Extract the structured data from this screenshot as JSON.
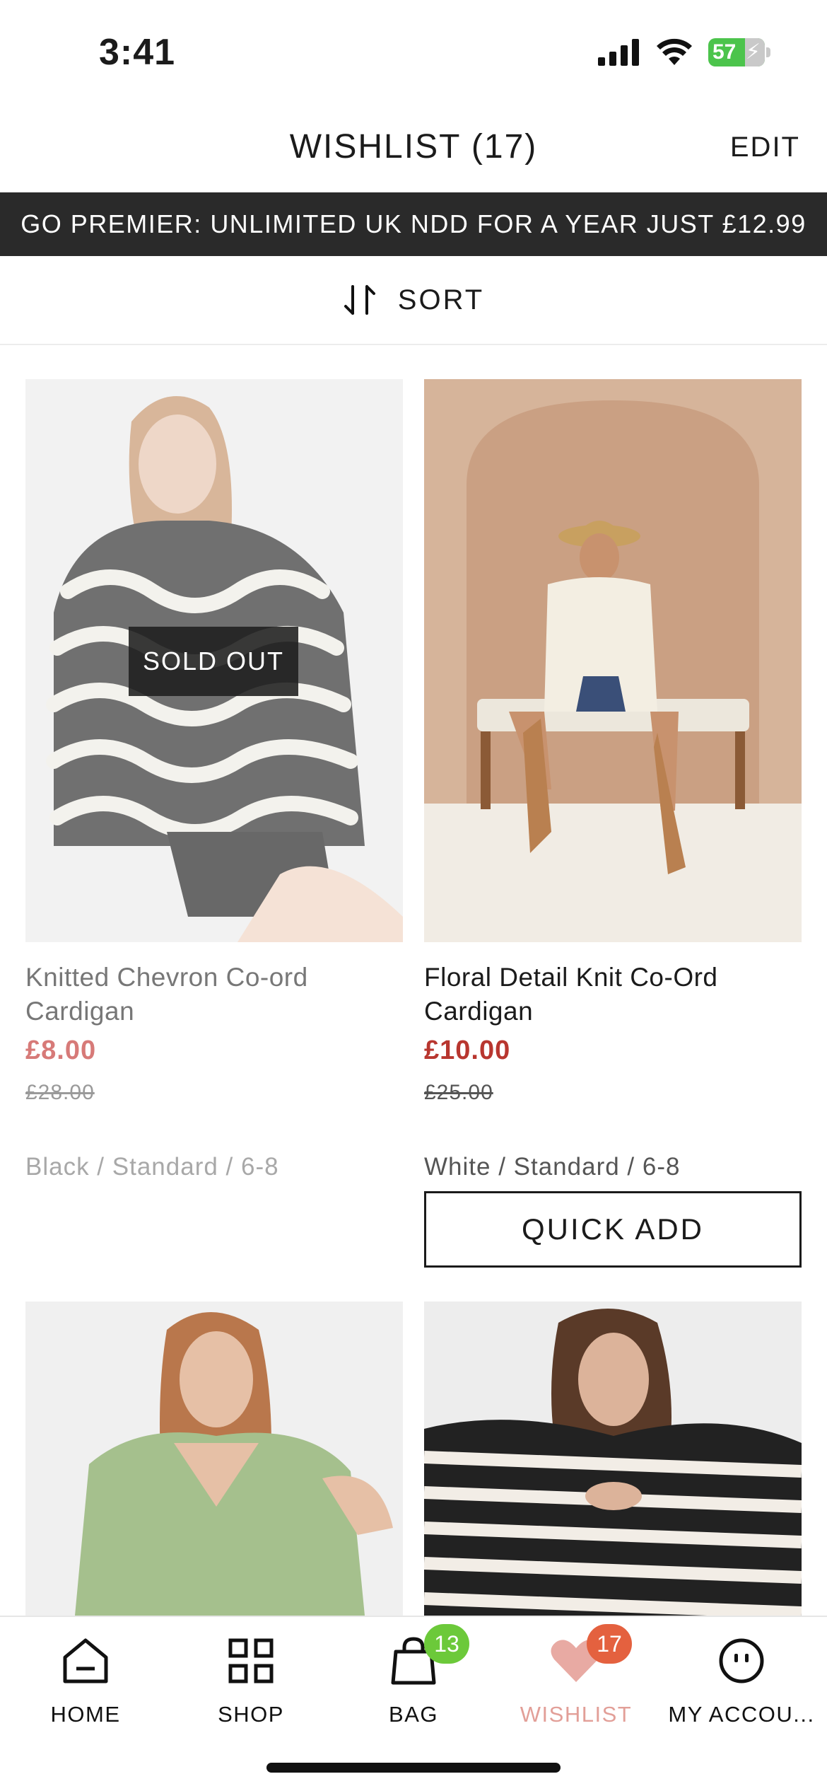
{
  "status_bar": {
    "time": "3:41",
    "battery": "57"
  },
  "header": {
    "title": "WISHLIST (17)",
    "edit_label": "EDIT"
  },
  "promo_banner": {
    "text": "GO PREMIER: UNLIMITED UK NDD FOR A YEAR JUST £12.99"
  },
  "sort": {
    "label": "SORT"
  },
  "products": [
    {
      "name": "Knitted Chevron Co-ord Cardigan",
      "price": "£8.00",
      "rrp": "£28.00",
      "variant": "Black / Standard / 6-8",
      "badge": "SOLD OUT"
    },
    {
      "name": "Floral Detail Knit Co-Ord Cardigan",
      "price": "£10.00",
      "rrp": "£25.00",
      "variant": "White / Standard / 6-8",
      "action_label": "QUICK ADD"
    },
    {},
    {}
  ],
  "tab_bar": {
    "items": [
      {
        "label": "HOME",
        "icon": "home-icon"
      },
      {
        "label": "SHOP",
        "icon": "grid-icon"
      },
      {
        "label": "BAG",
        "icon": "bag-icon",
        "badge": "13"
      },
      {
        "label": "WISHLIST",
        "icon": "heart-icon",
        "badge": "17",
        "selected": true
      },
      {
        "label": "MY ACCOU...",
        "icon": "account-icon"
      }
    ]
  },
  "colors": {
    "accent_price": "#b8362f",
    "wishlist_active": "#e29f98",
    "bag_badge": "#6cc93a",
    "wishlist_badge": "#e4613f",
    "banner_bg": "#2a2a2a"
  }
}
